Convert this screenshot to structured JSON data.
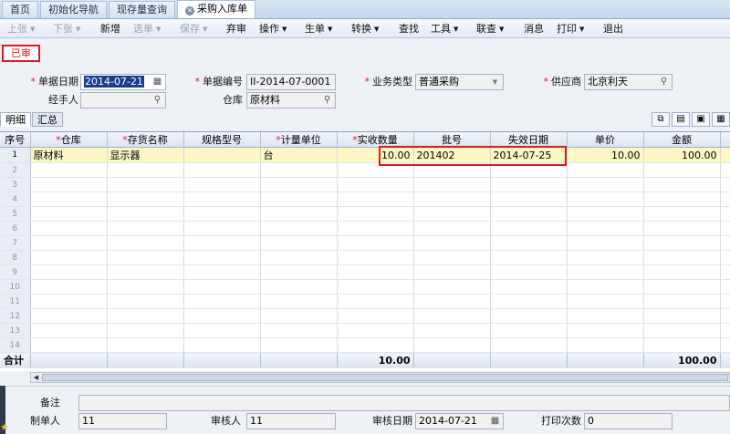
{
  "tabs": [
    {
      "label": "首页"
    },
    {
      "label": "初始化导航"
    },
    {
      "label": "现存量查询"
    },
    {
      "label": "采购入库单",
      "active": true
    }
  ],
  "toolbar": {
    "prev": "上张",
    "next": "下张",
    "new": "新增",
    "select": "选单",
    "save": "保存",
    "unaudit": "弃审",
    "operate": "操作",
    "generate": "生单",
    "convert": "转换",
    "find": "查找",
    "tools": "工具",
    "link": "联查",
    "message": "消息",
    "print": "打印",
    "exit": "退出"
  },
  "status": "已审",
  "header": {
    "date_label": "单据日期",
    "date_value": "2014-07-21",
    "no_label": "单据编号",
    "no_value": "II-2014-07-0001",
    "biztype_label": "业务类型",
    "biztype_value": "普通采购",
    "supplier_label": "供应商",
    "supplier_value": "北京利天",
    "handler_label": "经手人",
    "handler_value": "",
    "warehouse_label": "仓库",
    "warehouse_value": "原材料"
  },
  "subtabs": {
    "detail": "明细",
    "summary": "汇总"
  },
  "grid": {
    "columns": [
      "序号",
      "仓库",
      "存货名称",
      "规格型号",
      "计量单位",
      "实收数量",
      "批号",
      "失效日期",
      "单价",
      "金额"
    ],
    "required": [
      false,
      true,
      true,
      false,
      true,
      true,
      false,
      false,
      false,
      false
    ],
    "rows": [
      {
        "no": "1",
        "warehouse": "原材料",
        "item": "显示器",
        "spec": "",
        "unit": "台",
        "qty": "10.00",
        "batch": "201402",
        "expiry": "2014-07-25",
        "price": "10.00",
        "amount": "100.00"
      }
    ],
    "empty_row_numbers": [
      "2",
      "3",
      "4",
      "5",
      "6",
      "7",
      "8",
      "9",
      "10",
      "11",
      "12",
      "13",
      "14"
    ],
    "total_label": "合计",
    "total_qty": "10.00",
    "total_amount": "100.00"
  },
  "footer": {
    "remark_label": "备注",
    "remark_value": "",
    "maker_label": "制单人",
    "maker_value": "11",
    "auditor_label": "审核人",
    "auditor_value": "11",
    "audit_date_label": "审核日期",
    "audit_date_value": "2014-07-21",
    "print_count_label": "打印次数",
    "print_count_value": "0"
  },
  "colors": {
    "required": "#e0181b",
    "selected_row": "#fdf7c4",
    "highlight_box": "#e0181b"
  }
}
